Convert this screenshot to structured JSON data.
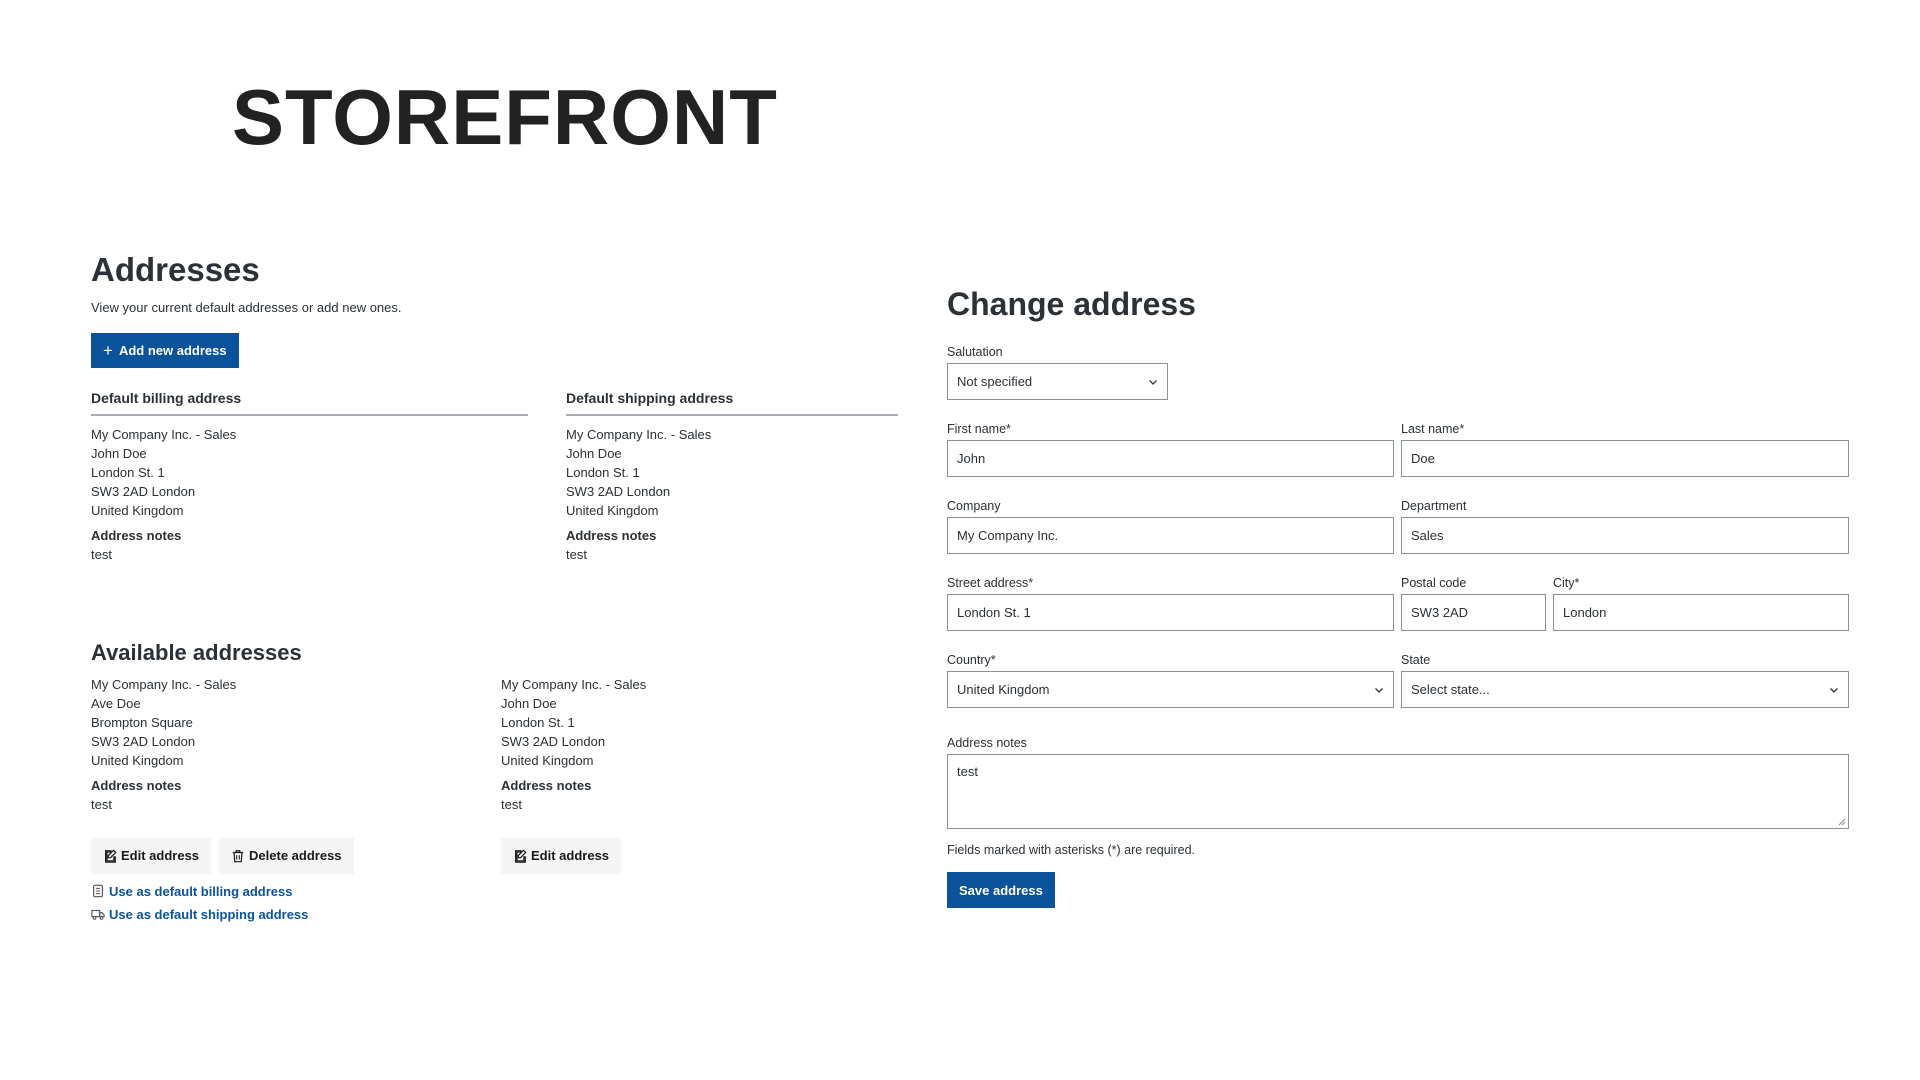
{
  "logo": "STOREFRONT",
  "addresses": {
    "title": "Addresses",
    "subtitle": "View your current default addresses or add new ones.",
    "add_button": "Add new address",
    "default_billing": {
      "title": "Default billing address",
      "lines": [
        "My Company Inc. - Sales",
        "John Doe",
        "London St. 1",
        "SW3 2AD London",
        "United Kingdom"
      ],
      "notes_label": "Address notes",
      "notes": "test"
    },
    "default_shipping": {
      "title": "Default shipping address",
      "lines": [
        "My Company Inc. - Sales",
        "John Doe",
        "London St. 1",
        "SW3 2AD London",
        "United Kingdom"
      ],
      "notes_label": "Address notes",
      "notes": "test"
    }
  },
  "available": {
    "title": "Available addresses",
    "items": [
      {
        "lines": [
          "My Company Inc. - Sales",
          "Ave Doe",
          "Brompton Square",
          "SW3 2AD London",
          "United Kingdom"
        ],
        "notes_label": "Address notes",
        "notes": "test",
        "edit_label": "Edit address",
        "delete_label": "Delete address",
        "use_billing_label": "Use as default billing address",
        "use_shipping_label": "Use as default shipping address"
      },
      {
        "lines": [
          "My Company Inc. - Sales",
          "John Doe",
          "London St. 1",
          "SW3 2AD London",
          "United Kingdom"
        ],
        "notes_label": "Address notes",
        "notes": "test",
        "edit_label": "Edit address"
      }
    ]
  },
  "form": {
    "title": "Change address",
    "salutation": {
      "label": "Salutation",
      "value": "Not specified"
    },
    "first_name": {
      "label": "First name*",
      "value": "John"
    },
    "last_name": {
      "label": "Last name*",
      "value": "Doe"
    },
    "company": {
      "label": "Company",
      "value": "My Company Inc."
    },
    "department": {
      "label": "Department",
      "value": "Sales"
    },
    "street": {
      "label": "Street address*",
      "value": "London St. 1"
    },
    "postal": {
      "label": "Postal code",
      "value": "SW3 2AD"
    },
    "city": {
      "label": "City*",
      "value": "London"
    },
    "country": {
      "label": "Country*",
      "value": "United Kingdom"
    },
    "state": {
      "label": "State",
      "value": "Select state..."
    },
    "notes": {
      "label": "Address notes",
      "value": "test"
    },
    "required_note": "Fields marked with asterisks (*) are required.",
    "save_label": "Save address"
  },
  "colors": {
    "primary": "#0b539b",
    "text": "#2b3136",
    "border": "#8a9299"
  }
}
